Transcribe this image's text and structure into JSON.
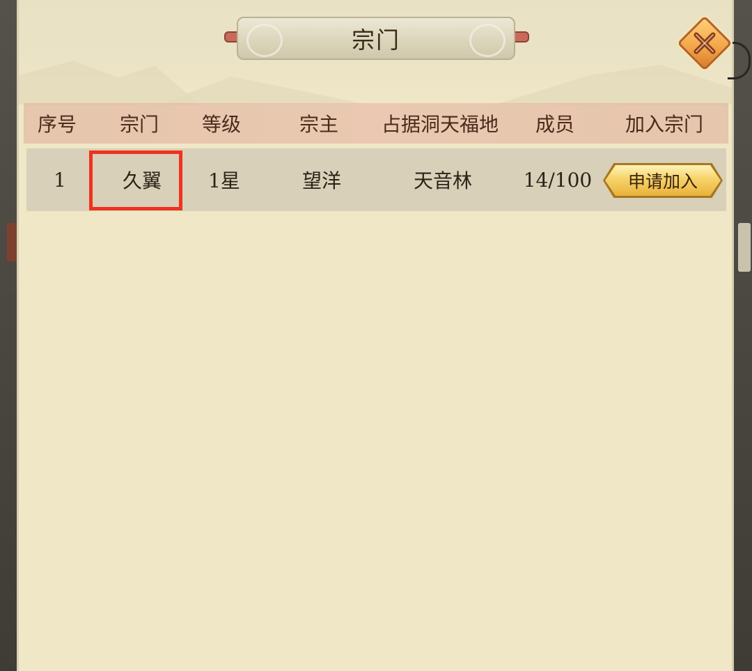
{
  "dialog": {
    "title": "宗门"
  },
  "table": {
    "columns": [
      "序号",
      "宗门",
      "等级",
      "宗主",
      "占据洞天福地",
      "成员",
      "加入宗门"
    ],
    "rows": [
      {
        "index": "1",
        "sect": "久翼",
        "level": "1星",
        "leader": "望洋",
        "territory": "天音林",
        "members": "14/100",
        "join_label": "申请加入"
      }
    ]
  },
  "icons": {
    "close": "close-x-icon"
  },
  "colors": {
    "panel_bg": "#efe7c6",
    "header_bg": "#e8beaa",
    "row_bg": "#d8d0b8",
    "highlight": "#f0321f",
    "button_gold": "#f6d36a",
    "close_orange": "#f2a447"
  }
}
